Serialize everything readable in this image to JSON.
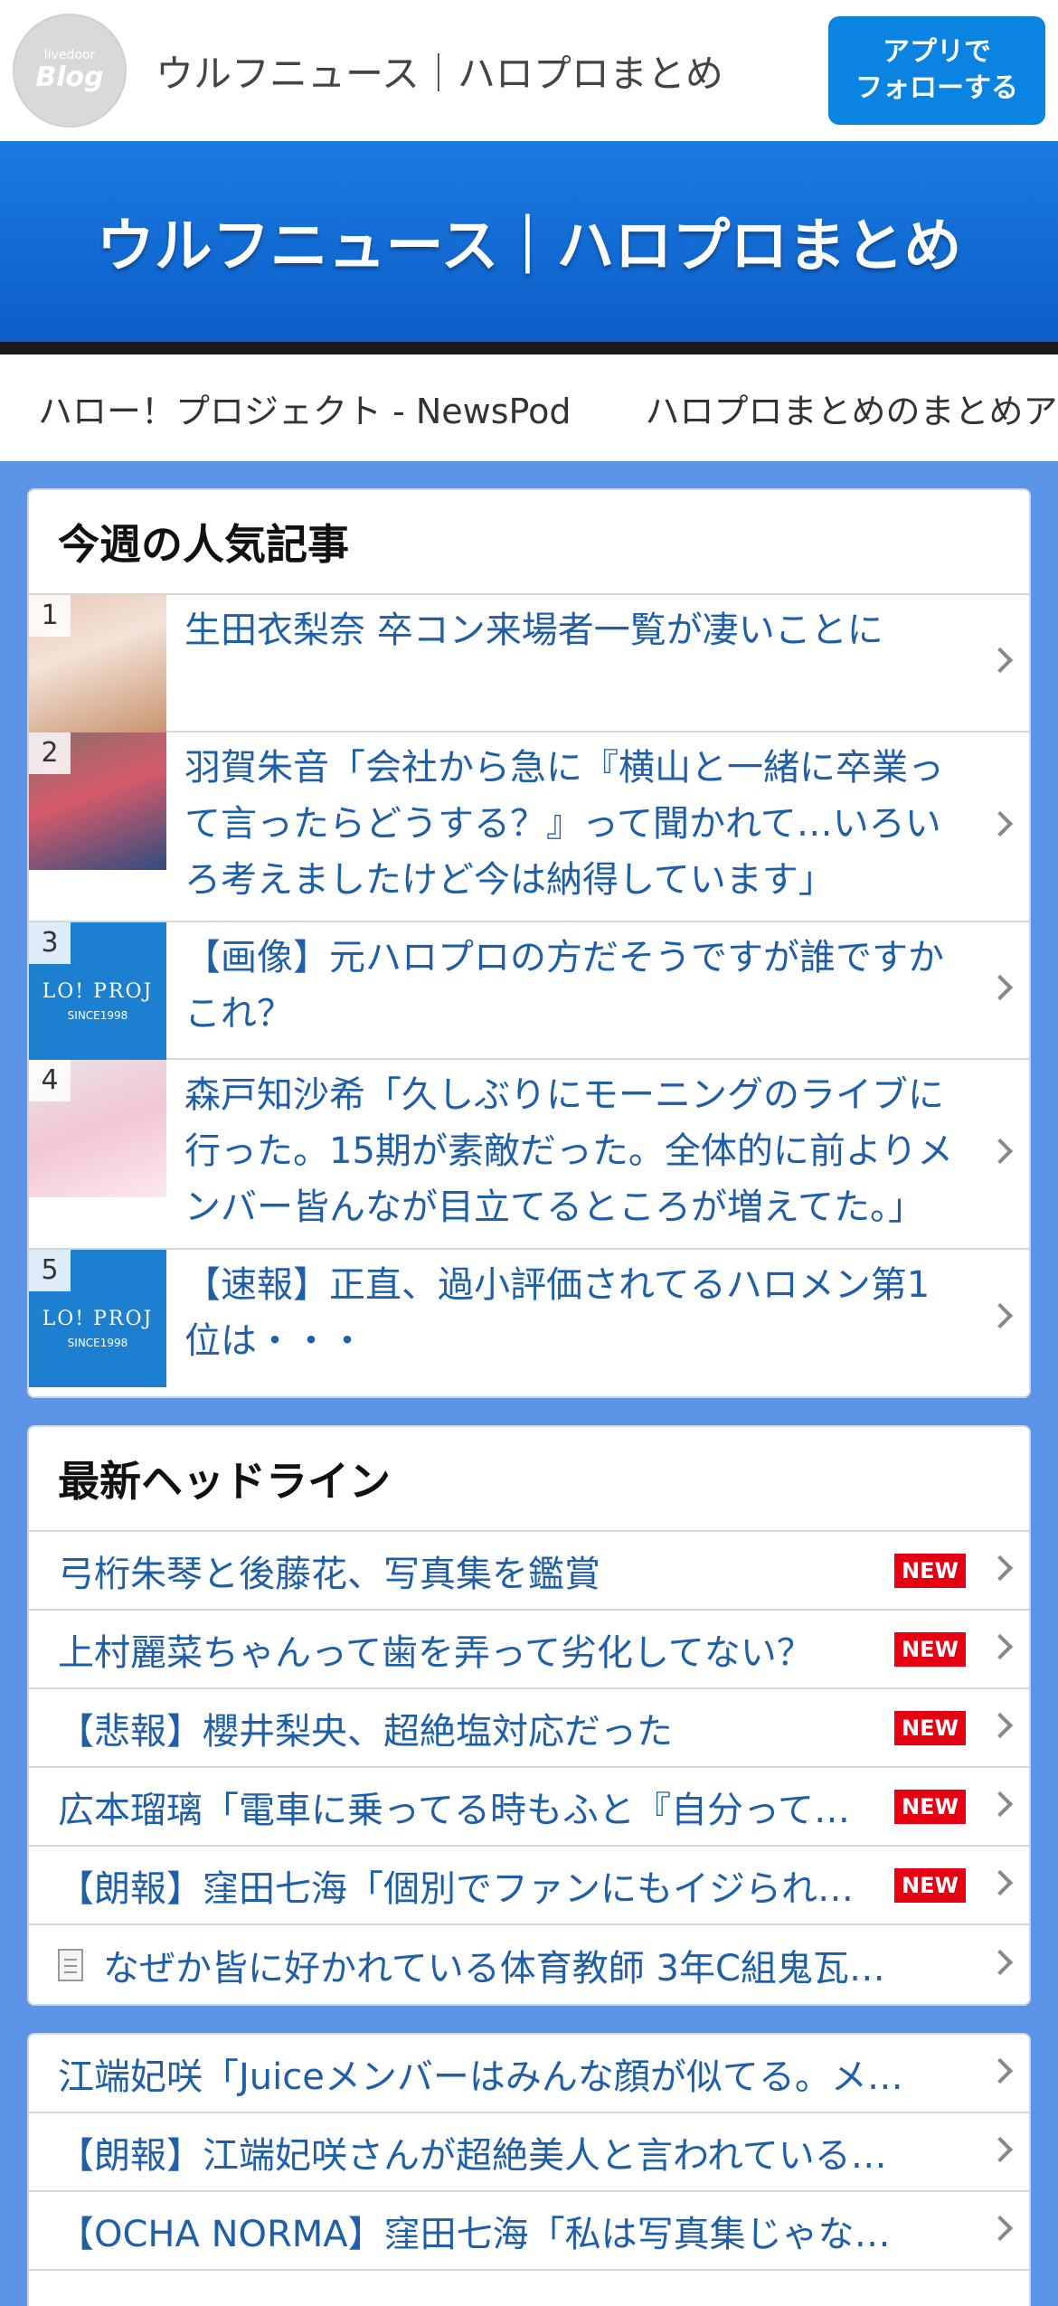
{
  "header": {
    "logo_small": "livedoor",
    "logo_big": "Blog",
    "site_title": "ウルフニュース｜ハロプロまとめ",
    "follow_line1": "アプリで",
    "follow_line2": "フォローする"
  },
  "banner": {
    "title": "ウルフニュース｜ハロプロまとめ"
  },
  "links": [
    "ハロー！プロジェクト - NewsPod",
    "ハロプロまとめのまとめア"
  ],
  "popular": {
    "heading": "今週の人気記事",
    "items": [
      {
        "rank": "1",
        "title": "生田衣梨奈 卒コン来場者一覧が凄いことに"
      },
      {
        "rank": "2",
        "title": "羽賀朱音「会社から急に『横山と一緒に卒業って言ったらどうする？』って聞かれて…いろいろ考えましたけど今は納得しています」"
      },
      {
        "rank": "3",
        "title": "【画像】元ハロプロの方だそうですが誰ですかこれ？",
        "thumb_line1": "LO! PROJ",
        "thumb_line2": "SINCE1998"
      },
      {
        "rank": "4",
        "title": "森戸知沙希「久しぶりにモーニングのライブに行った。15期が素敵だった。全体的に前よりメンバー皆んなが目立てるところが増えてた。」"
      },
      {
        "rank": "5",
        "title": "【速報】正直、過小評価されてるハロメン第1位は・・・",
        "thumb_line1": "LO! PROJ",
        "thumb_line2": "SINCE1998"
      }
    ]
  },
  "headlines": {
    "heading": "最新ヘッドライン",
    "new_label": "NEW",
    "items": [
      {
        "title": "弓桁朱琴と後藤花、写真集を鑑賞"
      },
      {
        "title": "上村麗菜ちゃんって歯を弄って劣化してない？"
      },
      {
        "title": "【悲報】櫻井梨央、超絶塩対応だった"
      },
      {
        "title": "広本瑠璃「電車に乗ってる時もふと『自分って…"
      },
      {
        "title": "【朗報】窪田七海「個別でファンにもイジられ…"
      },
      {
        "title": "なぜか皆に好かれている体育教師 3年C組鬼瓦…"
      }
    ]
  },
  "more": {
    "items": [
      {
        "title": "江端妃咲「Juiceメンバーはみんな顔が似てる。メ…"
      },
      {
        "title": "【朗報】江端妃咲さんが超絶美人と言われている…"
      },
      {
        "title": "【OCHA NORMA】窪田七海「私は写真集じゃな…"
      }
    ]
  }
}
